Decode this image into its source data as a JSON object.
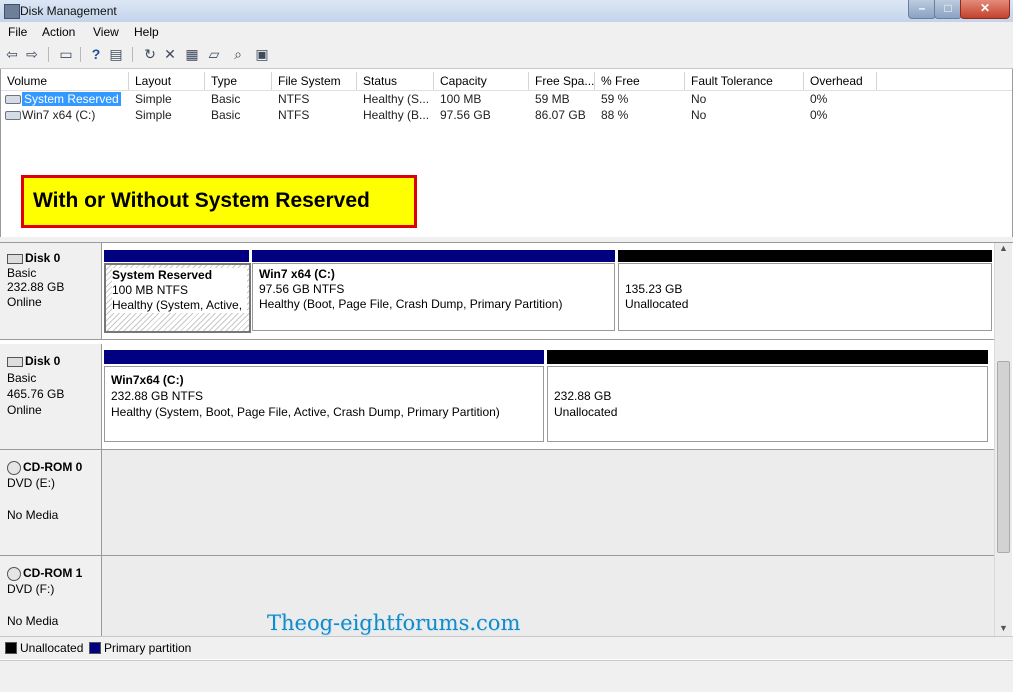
{
  "window": {
    "title": "Disk Management"
  },
  "menu": [
    "File",
    "Action",
    "View",
    "Help"
  ],
  "toolbar": [
    "back-icon",
    "forward-icon",
    "console-tree-icon",
    "help-icon",
    "list-view-icon",
    "refresh-icon",
    "delete-icon",
    "properties-icon",
    "open-icon",
    "explore-icon",
    "rescan-icon"
  ],
  "columns": [
    "Volume",
    "Layout",
    "Type",
    "File System",
    "Status",
    "Capacity",
    "Free Spa...",
    "% Free",
    "Fault Tolerance",
    "Overhead"
  ],
  "volumes": [
    {
      "volume": "System Reserved",
      "layout": "Simple",
      "type": "Basic",
      "fs": "NTFS",
      "status": "Healthy (S...",
      "capacity": "100 MB",
      "free": "59 MB",
      "pct": "59 %",
      "fault": "No",
      "overhead": "0%"
    },
    {
      "volume": "Win7 x64 (C:)",
      "layout": "Simple",
      "type": "Basic",
      "fs": "NTFS",
      "status": "Healthy (B...",
      "capacity": "97.56 GB",
      "free": "86.07 GB",
      "pct": "88 %",
      "fault": "No",
      "overhead": "0%"
    }
  ],
  "callout": "With or Without  System Reserved",
  "disks": [
    {
      "name": "Disk 0",
      "type": "Basic",
      "size": "232.88 GB",
      "state": "Online",
      "partitions": [
        {
          "title": "System Reserved",
          "size": "100 MB NTFS",
          "status": "Healthy (System, Active,"
        },
        {
          "title": "Win7 x64  (C:)",
          "size": "97.56 GB NTFS",
          "status": "Healthy (Boot, Page File, Crash Dump, Primary Partition)"
        },
        {
          "title": "",
          "size": "135.23 GB",
          "status": "Unallocated"
        }
      ]
    },
    {
      "name": "Disk 0",
      "type": "Basic",
      "size": "465.76 GB",
      "state": "Online",
      "partitions": [
        {
          "title": "Win7x64  (C:)",
          "size": "232.88 GB NTFS",
          "status": "Healthy (System, Boot, Page File, Active, Crash Dump, Primary Partition)"
        },
        {
          "title": "",
          "size": "232.88 GB",
          "status": "Unallocated"
        }
      ]
    }
  ],
  "cdroms": [
    {
      "name": "CD-ROM 0",
      "drive": "DVD (E:)",
      "media": "No Media"
    },
    {
      "name": "CD-ROM 1",
      "drive": "DVD (F:)",
      "media": "No Media"
    }
  ],
  "legend": [
    {
      "label": "Unallocated",
      "color": "#000000"
    },
    {
      "label": "Primary partition",
      "color": "#000080"
    }
  ],
  "watermark": "Theog-eightforums.com"
}
